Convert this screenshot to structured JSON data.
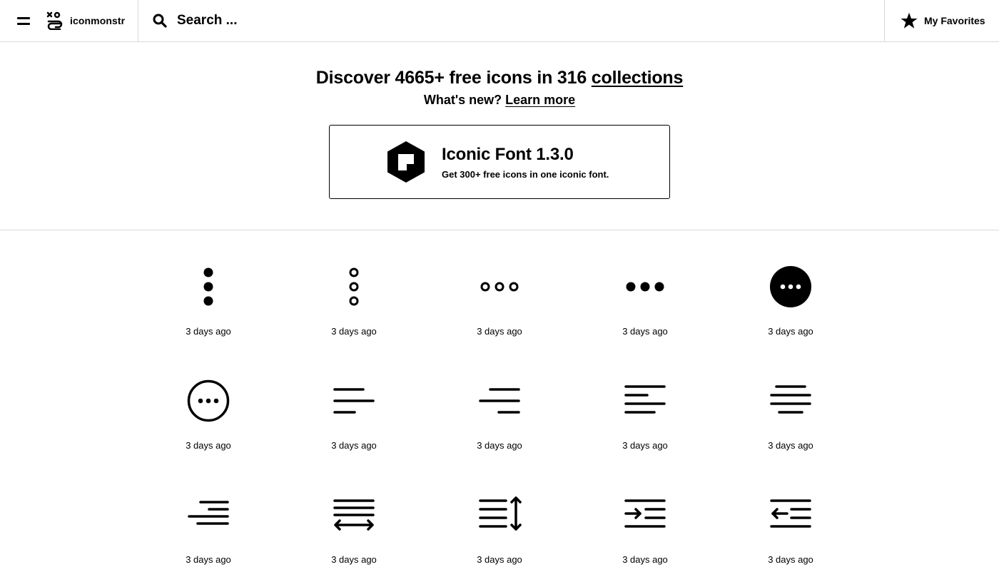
{
  "header": {
    "brand": "iconmonstr",
    "search_placeholder": "Search ...",
    "favorites_label": "My Favorites"
  },
  "hero": {
    "title_prefix": "Discover 4665+ free icons in 316 ",
    "title_link": "collections",
    "sub_prefix": "What's new? ",
    "sub_link": "Learn more",
    "promo_title": "Iconic Font 1.3.0",
    "promo_desc": "Get 300+ free icons in one iconic font."
  },
  "icons": [
    {
      "icon": "vertical-dots-filled-icon",
      "date": "3 days ago"
    },
    {
      "icon": "vertical-dots-outline-icon",
      "date": "3 days ago"
    },
    {
      "icon": "horizontal-dots-outline-icon",
      "date": "3 days ago"
    },
    {
      "icon": "horizontal-dots-filled-icon",
      "date": "3 days ago"
    },
    {
      "icon": "more-circle-filled-icon",
      "date": "3 days ago"
    },
    {
      "icon": "more-circle-outline-icon",
      "date": "3 days ago"
    },
    {
      "icon": "align-left-icon",
      "date": "3 days ago"
    },
    {
      "icon": "align-right-icon",
      "date": "3 days ago"
    },
    {
      "icon": "text-left-icon",
      "date": "3 days ago"
    },
    {
      "icon": "align-center-icon",
      "date": "3 days ago"
    },
    {
      "icon": "text-right-icon",
      "date": "3 days ago"
    },
    {
      "icon": "justify-horizontal-icon",
      "date": "3 days ago"
    },
    {
      "icon": "line-height-icon",
      "date": "3 days ago"
    },
    {
      "icon": "indent-icon",
      "date": "3 days ago"
    },
    {
      "icon": "outdent-icon",
      "date": "3 days ago"
    }
  ]
}
